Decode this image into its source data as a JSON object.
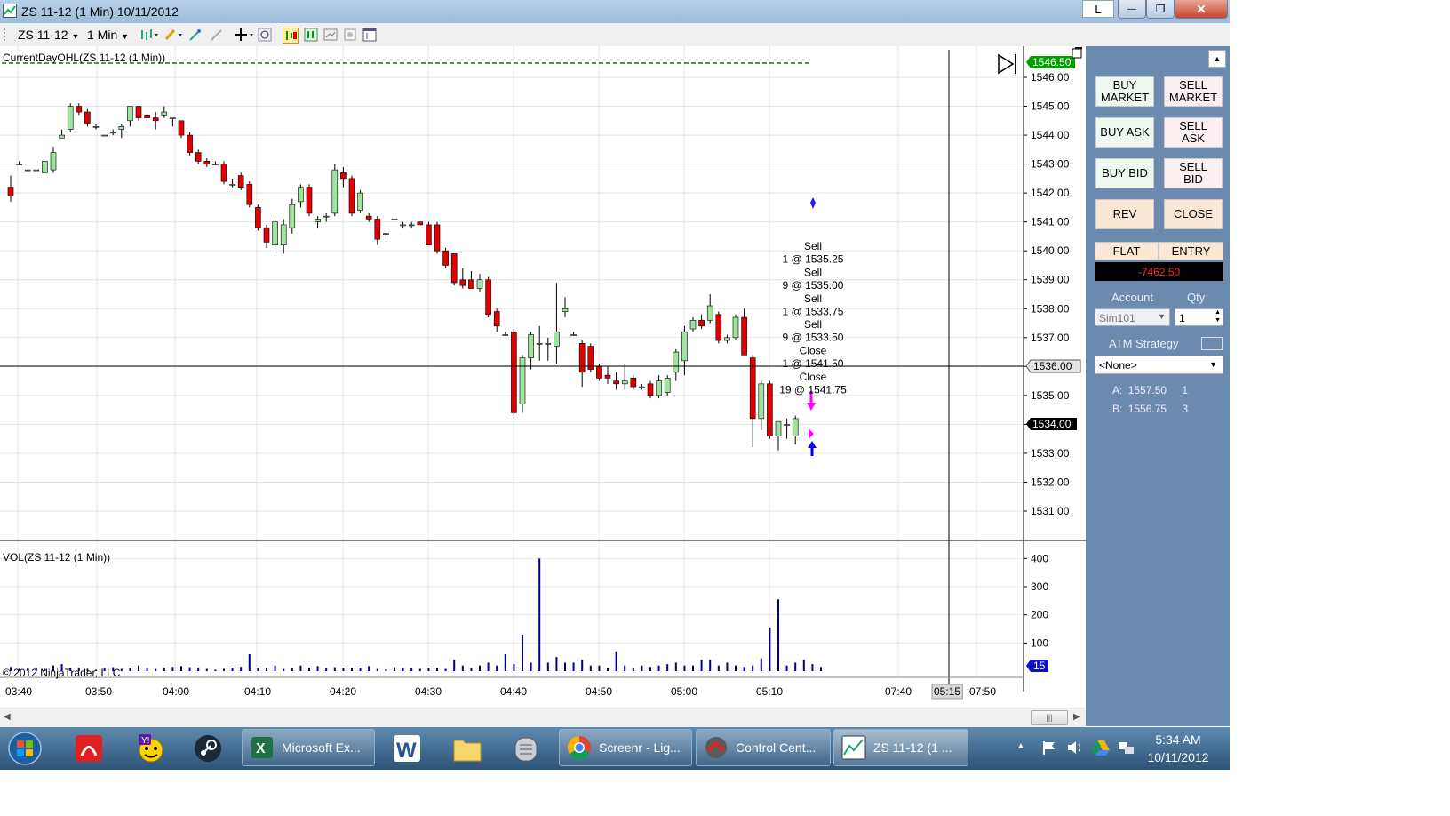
{
  "window": {
    "title": "ZS 11-12 (1 Min)  10/11/2012",
    "l_button": "L",
    "minimize_glyph": "—",
    "maximize_glyph": "❐",
    "close_glyph": "✕"
  },
  "toolbar": {
    "instrument": "ZS 11-12",
    "interval": "1 Min",
    "icons": [
      "bars-icon",
      "pencil-icon",
      "cursor-icon",
      "eraser-icon",
      "crosshair-icon",
      "zoom-icon",
      "chart-trader-icon",
      "properties-icon",
      "data-box-icon",
      "screenshot-icon",
      "window-icon"
    ]
  },
  "chart": {
    "indicator_label": "CurrentDayOHL(ZS 11-12 (1 Min))",
    "volume_label": "VOL(ZS 11-12 (1 Min))",
    "copyright": "© 2012 NinjaTrader, LLC",
    "price_axis": [
      "1546.00",
      "1545.00",
      "1544.00",
      "1543.00",
      "1542.00",
      "1541.00",
      "1540.00",
      "1539.00",
      "1538.00",
      "1537.00",
      "1536.00",
      "1535.00",
      "1534.00",
      "1533.00",
      "1532.00",
      "1531.00"
    ],
    "volume_axis": [
      "400",
      "300",
      "200",
      "100"
    ],
    "time_axis": [
      "03:40",
      "03:50",
      "04:00",
      "04:10",
      "04:20",
      "04:30",
      "04:40",
      "04:50",
      "05:00",
      "05:10",
      "07:40",
      "05:15",
      "07:50"
    ],
    "price_flags": {
      "high": "1546.50",
      "crosshair": "1536.00",
      "last": "1534.00",
      "volume_last": "15"
    },
    "colors": {
      "up": "#9fe49f",
      "down": "#e00000",
      "volume": "#00008b",
      "ohl_line": "#008000"
    },
    "executions": [
      {
        "side": "Sell",
        "fill": "1 @ 1535.25"
      },
      {
        "side": "Sell",
        "fill": "9 @ 1535.00"
      },
      {
        "side": "Sell",
        "fill": "1 @ 1533.75"
      },
      {
        "side": "Sell",
        "fill": "9 @ 1533.50"
      },
      {
        "side": "Close",
        "fill": "1 @ 1541.50"
      },
      {
        "side": "Close",
        "fill": "19 @ 1541.75"
      }
    ]
  },
  "chart_data": {
    "type": "candlestick",
    "ylim": [
      1530.5,
      1546.5
    ],
    "candles": [
      [
        1542.2,
        1542.6,
        1541.7,
        1541.9
      ],
      [
        1543.0,
        1543.1,
        1543.0,
        1543.0
      ],
      [
        1542.8,
        1542.8,
        1542.8,
        1542.8
      ],
      [
        1542.8,
        1542.8,
        1542.8,
        1542.8
      ],
      [
        1542.7,
        1543.1,
        1542.7,
        1543.1
      ],
      [
        1542.8,
        1543.6,
        1542.7,
        1543.4
      ],
      [
        1543.9,
        1544.2,
        1543.9,
        1544.0
      ],
      [
        1544.2,
        1545.1,
        1544.1,
        1545.0
      ],
      [
        1545.0,
        1545.1,
        1544.7,
        1544.8
      ],
      [
        1544.8,
        1544.9,
        1544.3,
        1544.4
      ],
      [
        1544.3,
        1544.4,
        1544.2,
        1544.3
      ],
      [
        1544.0,
        1544.0,
        1544.0,
        1544.0
      ],
      [
        1544.1,
        1544.2,
        1544.0,
        1544.1
      ],
      [
        1544.2,
        1544.4,
        1543.9,
        1544.3
      ],
      [
        1544.5,
        1545.0,
        1544.3,
        1545.0
      ],
      [
        1545.0,
        1545.0,
        1544.5,
        1544.6
      ],
      [
        1544.7,
        1544.7,
        1544.6,
        1544.6
      ],
      [
        1544.6,
        1544.8,
        1544.2,
        1544.5
      ],
      [
        1544.7,
        1545.0,
        1544.6,
        1544.8
      ],
      [
        1544.6,
        1544.6,
        1544.3,
        1544.6
      ],
      [
        1544.5,
        1544.5,
        1543.9,
        1544.0
      ],
      [
        1544.0,
        1544.1,
        1543.3,
        1543.4
      ],
      [
        1543.4,
        1543.5,
        1543.0,
        1543.1
      ],
      [
        1543.1,
        1543.2,
        1542.9,
        1543.0
      ],
      [
        1543.0,
        1543.1,
        1543.0,
        1543.0
      ],
      [
        1543.0,
        1543.1,
        1542.3,
        1542.4
      ],
      [
        1542.3,
        1542.5,
        1542.2,
        1542.3
      ],
      [
        1542.6,
        1542.7,
        1542.1,
        1542.2
      ],
      [
        1542.3,
        1542.4,
        1541.5,
        1541.6
      ],
      [
        1541.5,
        1541.6,
        1540.7,
        1540.8
      ],
      [
        1540.8,
        1540.9,
        1540.1,
        1540.3
      ],
      [
        1540.2,
        1541.1,
        1539.9,
        1541.0
      ],
      [
        1540.2,
        1541.1,
        1539.9,
        1540.9
      ],
      [
        1540.8,
        1541.8,
        1540.6,
        1541.6
      ],
      [
        1541.7,
        1542.3,
        1541.5,
        1542.2
      ],
      [
        1542.2,
        1542.3,
        1541.2,
        1541.3
      ],
      [
        1541.0,
        1541.2,
        1540.8,
        1541.1
      ],
      [
        1541.2,
        1541.3,
        1541.0,
        1541.2
      ],
      [
        1541.3,
        1543.0,
        1541.2,
        1542.8
      ],
      [
        1542.7,
        1542.9,
        1542.2,
        1542.5
      ],
      [
        1542.5,
        1542.6,
        1541.2,
        1541.3
      ],
      [
        1541.4,
        1542.1,
        1541.3,
        1542.0
      ],
      [
        1541.2,
        1541.3,
        1541.0,
        1541.1
      ],
      [
        1541.1,
        1541.2,
        1540.2,
        1540.4
      ],
      [
        1540.6,
        1540.7,
        1540.4,
        1540.6
      ],
      [
        1541.1,
        1541.1,
        1541.1,
        1541.1
      ],
      [
        1540.9,
        1541.0,
        1540.8,
        1540.9
      ],
      [
        1540.9,
        1541.0,
        1540.8,
        1540.9
      ],
      [
        1541.0,
        1541.0,
        1540.9,
        1540.9
      ],
      [
        1540.9,
        1541.0,
        1540.2,
        1540.2
      ],
      [
        1540.9,
        1541.0,
        1539.9,
        1540.0
      ],
      [
        1540.0,
        1540.1,
        1539.4,
        1539.5
      ],
      [
        1539.9,
        1539.9,
        1538.8,
        1538.9
      ],
      [
        1539.0,
        1539.4,
        1538.7,
        1538.8
      ],
      [
        1539.0,
        1539.3,
        1538.7,
        1538.7
      ],
      [
        1538.7,
        1539.2,
        1538.6,
        1539.0
      ],
      [
        1539.0,
        1539.1,
        1537.7,
        1537.8
      ],
      [
        1537.9,
        1538.0,
        1537.2,
        1537.4
      ],
      [
        1537.1,
        1537.2,
        1537.1,
        1537.1
      ],
      [
        1537.2,
        1537.3,
        1534.3,
        1534.4
      ],
      [
        1534.7,
        1536.4,
        1534.4,
        1536.3
      ],
      [
        1536.3,
        1537.2,
        1535.9,
        1537.1
      ],
      [
        1536.8,
        1537.4,
        1536.2,
        1536.8
      ],
      [
        1536.8,
        1537.0,
        1536.2,
        1536.8
      ],
      [
        1536.7,
        1538.9,
        1536.1,
        1537.2
      ],
      [
        1537.9,
        1538.4,
        1537.7,
        1538.0
      ],
      [
        1537.1,
        1537.2,
        1537.1,
        1537.1
      ],
      [
        1536.8,
        1536.9,
        1535.3,
        1535.8
      ],
      [
        1536.7,
        1536.8,
        1535.8,
        1535.9
      ],
      [
        1536.0,
        1536.1,
        1535.5,
        1535.6
      ],
      [
        1535.7,
        1536.0,
        1535.4,
        1535.6
      ],
      [
        1535.5,
        1535.8,
        1535.2,
        1535.4
      ],
      [
        1535.4,
        1536.1,
        1535.2,
        1535.5
      ],
      [
        1535.6,
        1535.7,
        1535.2,
        1535.3
      ],
      [
        1535.3,
        1535.4,
        1535.2,
        1535.3
      ],
      [
        1535.4,
        1535.5,
        1534.9,
        1535.0
      ],
      [
        1535.0,
        1535.7,
        1534.9,
        1535.5
      ],
      [
        1535.1,
        1535.7,
        1535.0,
        1535.6
      ],
      [
        1535.8,
        1536.6,
        1535.5,
        1536.5
      ],
      [
        1536.2,
        1537.4,
        1535.7,
        1537.2
      ],
      [
        1537.3,
        1537.7,
        1537.2,
        1537.6
      ],
      [
        1537.6,
        1537.8,
        1537.3,
        1537.4
      ],
      [
        1537.6,
        1538.5,
        1537.5,
        1538.1
      ],
      [
        1537.8,
        1537.9,
        1536.8,
        1536.9
      ],
      [
        1536.9,
        1537.1,
        1536.8,
        1537.0
      ],
      [
        1537.0,
        1537.8,
        1536.9,
        1537.7
      ],
      [
        1537.7,
        1538.0,
        1536.4,
        1536.4
      ],
      [
        1536.3,
        1536.4,
        1533.2,
        1534.2
      ],
      [
        1534.2,
        1535.5,
        1533.8,
        1535.4
      ],
      [
        1535.4,
        1535.5,
        1533.5,
        1533.6
      ],
      [
        1533.6,
        1534.1,
        1533.1,
        1534.1
      ],
      [
        1534.0,
        1534.2,
        1533.5,
        1534.0
      ],
      [
        1533.6,
        1534.3,
        1533.3,
        1534.2
      ]
    ],
    "volumes": [
      15,
      8,
      10,
      12,
      8,
      20,
      25,
      10,
      12,
      8,
      5,
      10,
      14,
      8,
      12,
      20,
      10,
      8,
      12,
      15,
      18,
      14,
      12,
      8,
      5,
      8,
      12,
      15,
      60,
      12,
      10,
      20,
      8,
      10,
      20,
      12,
      18,
      10,
      14,
      12,
      10,
      12,
      18,
      8,
      6,
      14,
      10,
      10,
      8,
      12,
      10,
      8,
      40,
      20,
      10,
      20,
      30,
      20,
      60,
      25,
      130,
      30,
      400,
      30,
      50,
      30,
      30,
      40,
      20,
      20,
      10,
      70,
      20,
      10,
      20,
      15,
      20,
      25,
      30,
      20,
      20,
      40,
      40,
      20,
      30,
      20,
      15,
      20,
      45,
      155,
      255,
      20,
      30,
      40,
      25,
      15
    ],
    "volume_ylim": [
      0,
      420
    ],
    "x_ticks": [
      "03:40",
      "03:50",
      "04:00",
      "04:10",
      "04:20",
      "04:30",
      "04:40",
      "04:50",
      "05:00",
      "05:10",
      "07:40",
      "05:15",
      "07:50"
    ],
    "y_ticks": [
      "1546.00",
      "1545.00",
      "1544.00",
      "1543.00",
      "1542.00",
      "1541.00",
      "1540.00",
      "1539.00",
      "1538.00",
      "1537.00",
      "1536.00",
      "1535.00",
      "1534.00",
      "1533.00",
      "1532.00",
      "1531.00"
    ],
    "ohl_line_value": 1546.5,
    "crosshair_value": 1536.0
  },
  "panel": {
    "buy_market": "BUY\nMARKET",
    "sell_market": "SELL\nMARKET",
    "buy_ask": "BUY ASK",
    "sell_ask": "SELL\nASK",
    "buy_bid": "BUY BID",
    "sell_bid": "SELL\nBID",
    "rev": "REV",
    "close": "CLOSE",
    "position": "FLAT",
    "entry": "ENTRY",
    "pnl": "-7462.50",
    "account_label": "Account",
    "qty_label": "Qty",
    "account_value": "Sim101",
    "qty_value": "1",
    "atm_label": "ATM Strategy",
    "atm_value": "<None>",
    "ask_label": "A:",
    "ask_price": "1557.50",
    "ask_size": "1",
    "bid_label": "B:",
    "bid_price": "1556.75",
    "bid_size": "3"
  },
  "taskbar": {
    "tasks": [
      "Microsoft Ex...",
      "Screenr - Lig...",
      "Control Cent...",
      "ZS 11-12 (1 ..."
    ],
    "time": "5:34 AM",
    "date": "10/11/2012"
  }
}
